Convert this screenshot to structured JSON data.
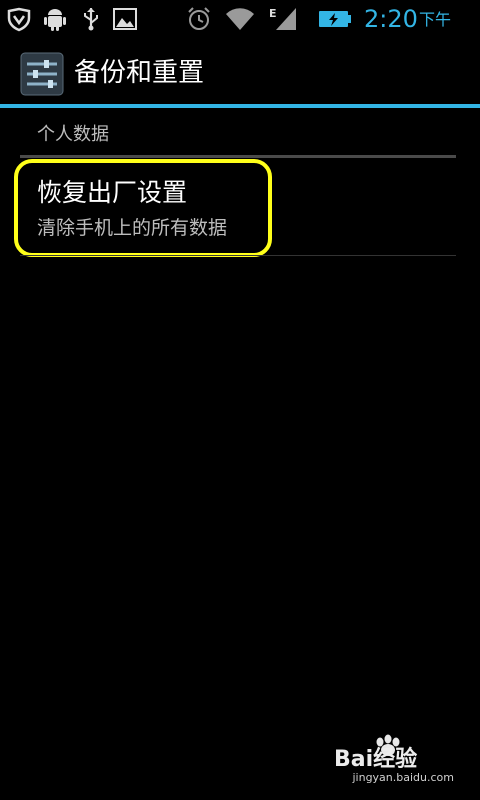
{
  "status_bar": {
    "icons": [
      "shield-icon",
      "android-debug-icon",
      "usb-icon",
      "image-icon",
      "alarm-icon",
      "wifi-icon",
      "signal-icon",
      "battery-charging-icon"
    ],
    "network_type": "E",
    "time": "2:20",
    "ampm": "下午",
    "accent_color": "#33b5e5"
  },
  "action_bar": {
    "icon": "settings-sliders-icon",
    "title": "备份和重置"
  },
  "content": {
    "section_header": "个人数据",
    "items": [
      {
        "title": "恢复出厂设置",
        "summary": "清除手机上的所有数据",
        "highlight_color": "#ffff1a"
      }
    ]
  },
  "watermark": {
    "brand": "Bai经验",
    "url": "jingyan.baidu.com"
  }
}
